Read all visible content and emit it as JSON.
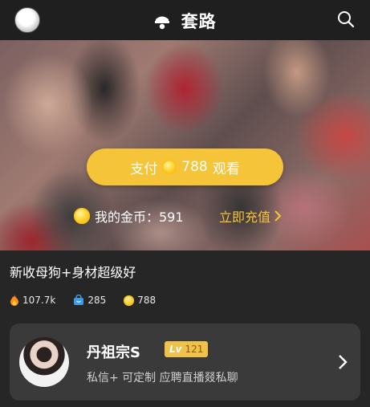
{
  "header": {
    "brand_title": "套路",
    "avatar_icon": "avatar-icon",
    "logo_icon": "hat-logo-icon",
    "search_icon": "search-icon"
  },
  "video": {
    "pay_button": {
      "prefix": "支付",
      "price": "788",
      "suffix": "观看"
    },
    "balance": {
      "label": "我的金币：591"
    },
    "recharge_label": "立即充值"
  },
  "post": {
    "title": "新收母狗+身材超级好",
    "stats": {
      "views": "107.7k",
      "purchases": "285",
      "coins": "788"
    }
  },
  "creator": {
    "name": "丹祖宗S",
    "level_prefix": "Lv",
    "level": "121",
    "description": "私信+ 可定制 应聘直播叕私聊"
  },
  "colors": {
    "accent_gold": "#f3c440",
    "background": "#262626",
    "card": "#3a3a3a"
  }
}
